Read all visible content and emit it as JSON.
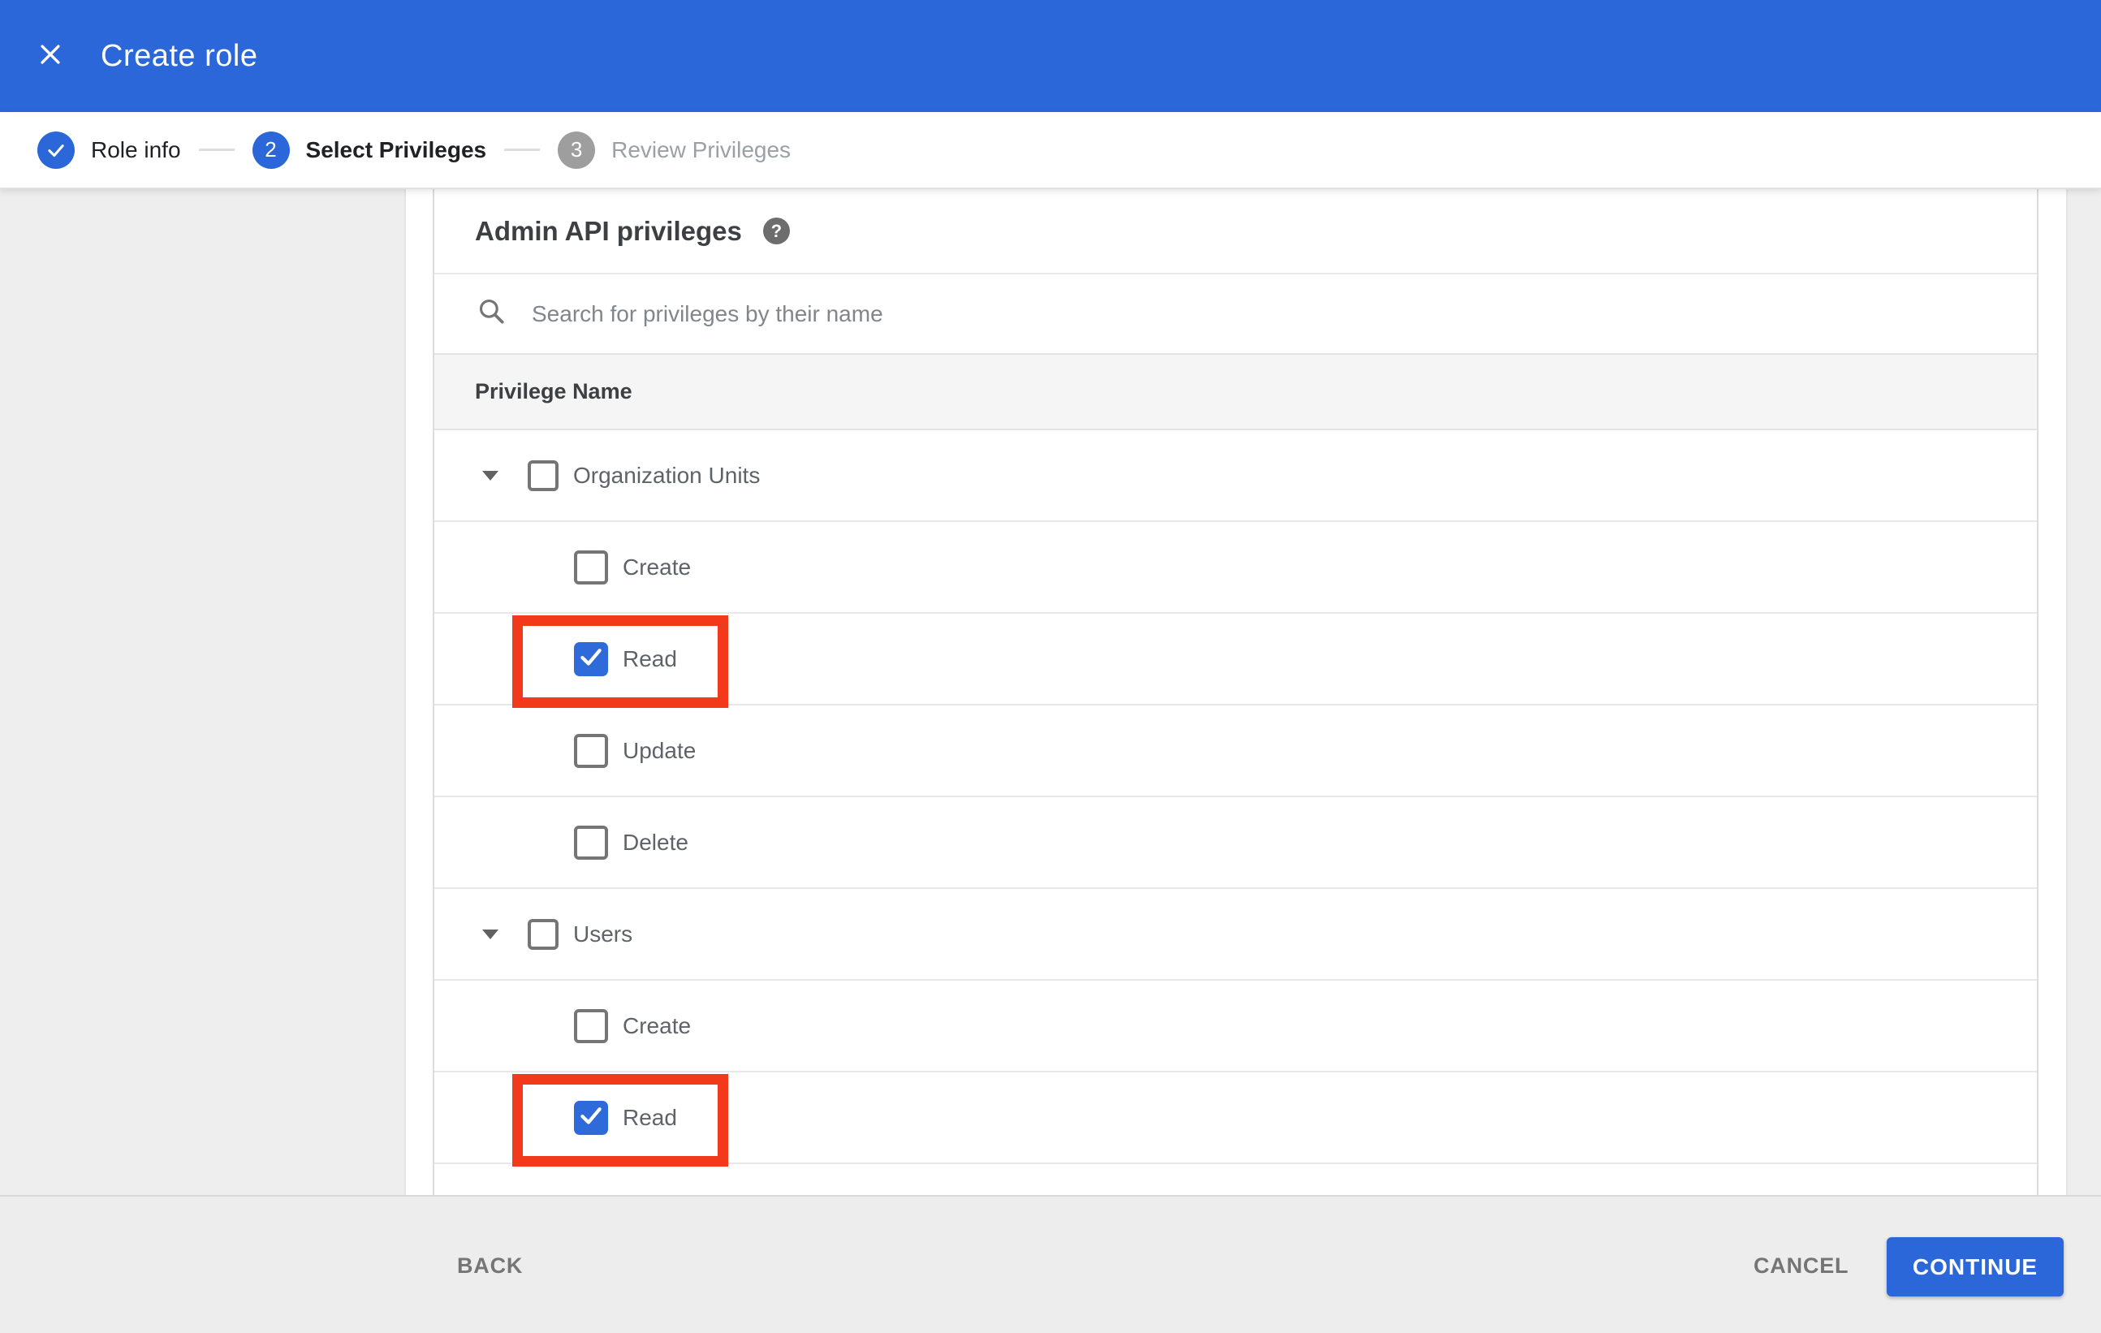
{
  "header": {
    "title": "Create role"
  },
  "stepper": {
    "steps": [
      {
        "label": "Role info",
        "state": "done",
        "icon": "check"
      },
      {
        "label": "Select Privileges",
        "state": "active",
        "num": "2"
      },
      {
        "label": "Review Privileges",
        "state": "upcoming",
        "num": "3"
      }
    ]
  },
  "privileges": {
    "heading": "Admin API privileges",
    "help_glyph": "?",
    "search_placeholder": "Search for privileges by their name",
    "column_header": "Privilege Name",
    "groups": [
      {
        "label": "Organization Units",
        "checked": false,
        "expanded": true,
        "children": [
          {
            "label": "Create",
            "checked": false,
            "highlighted": false
          },
          {
            "label": "Read",
            "checked": true,
            "highlighted": true
          },
          {
            "label": "Update",
            "checked": false,
            "highlighted": false
          },
          {
            "label": "Delete",
            "checked": false,
            "highlighted": false
          }
        ]
      },
      {
        "label": "Users",
        "checked": false,
        "expanded": true,
        "children": [
          {
            "label": "Create",
            "checked": false,
            "highlighted": false
          },
          {
            "label": "Read",
            "checked": true,
            "highlighted": true
          }
        ]
      }
    ]
  },
  "footer": {
    "back_label": "BACK",
    "cancel_label": "CANCEL",
    "continue_label": "CONTINUE"
  },
  "colors": {
    "app_bar_blue": "#2b67d8",
    "checkbox_checked_blue": "#2e6ada",
    "highlight_red": "#f3391b",
    "step_inactive_gray": "#9e9e9e",
    "table_header_bg": "#f5f5f5",
    "footer_bg": "#ededed"
  }
}
